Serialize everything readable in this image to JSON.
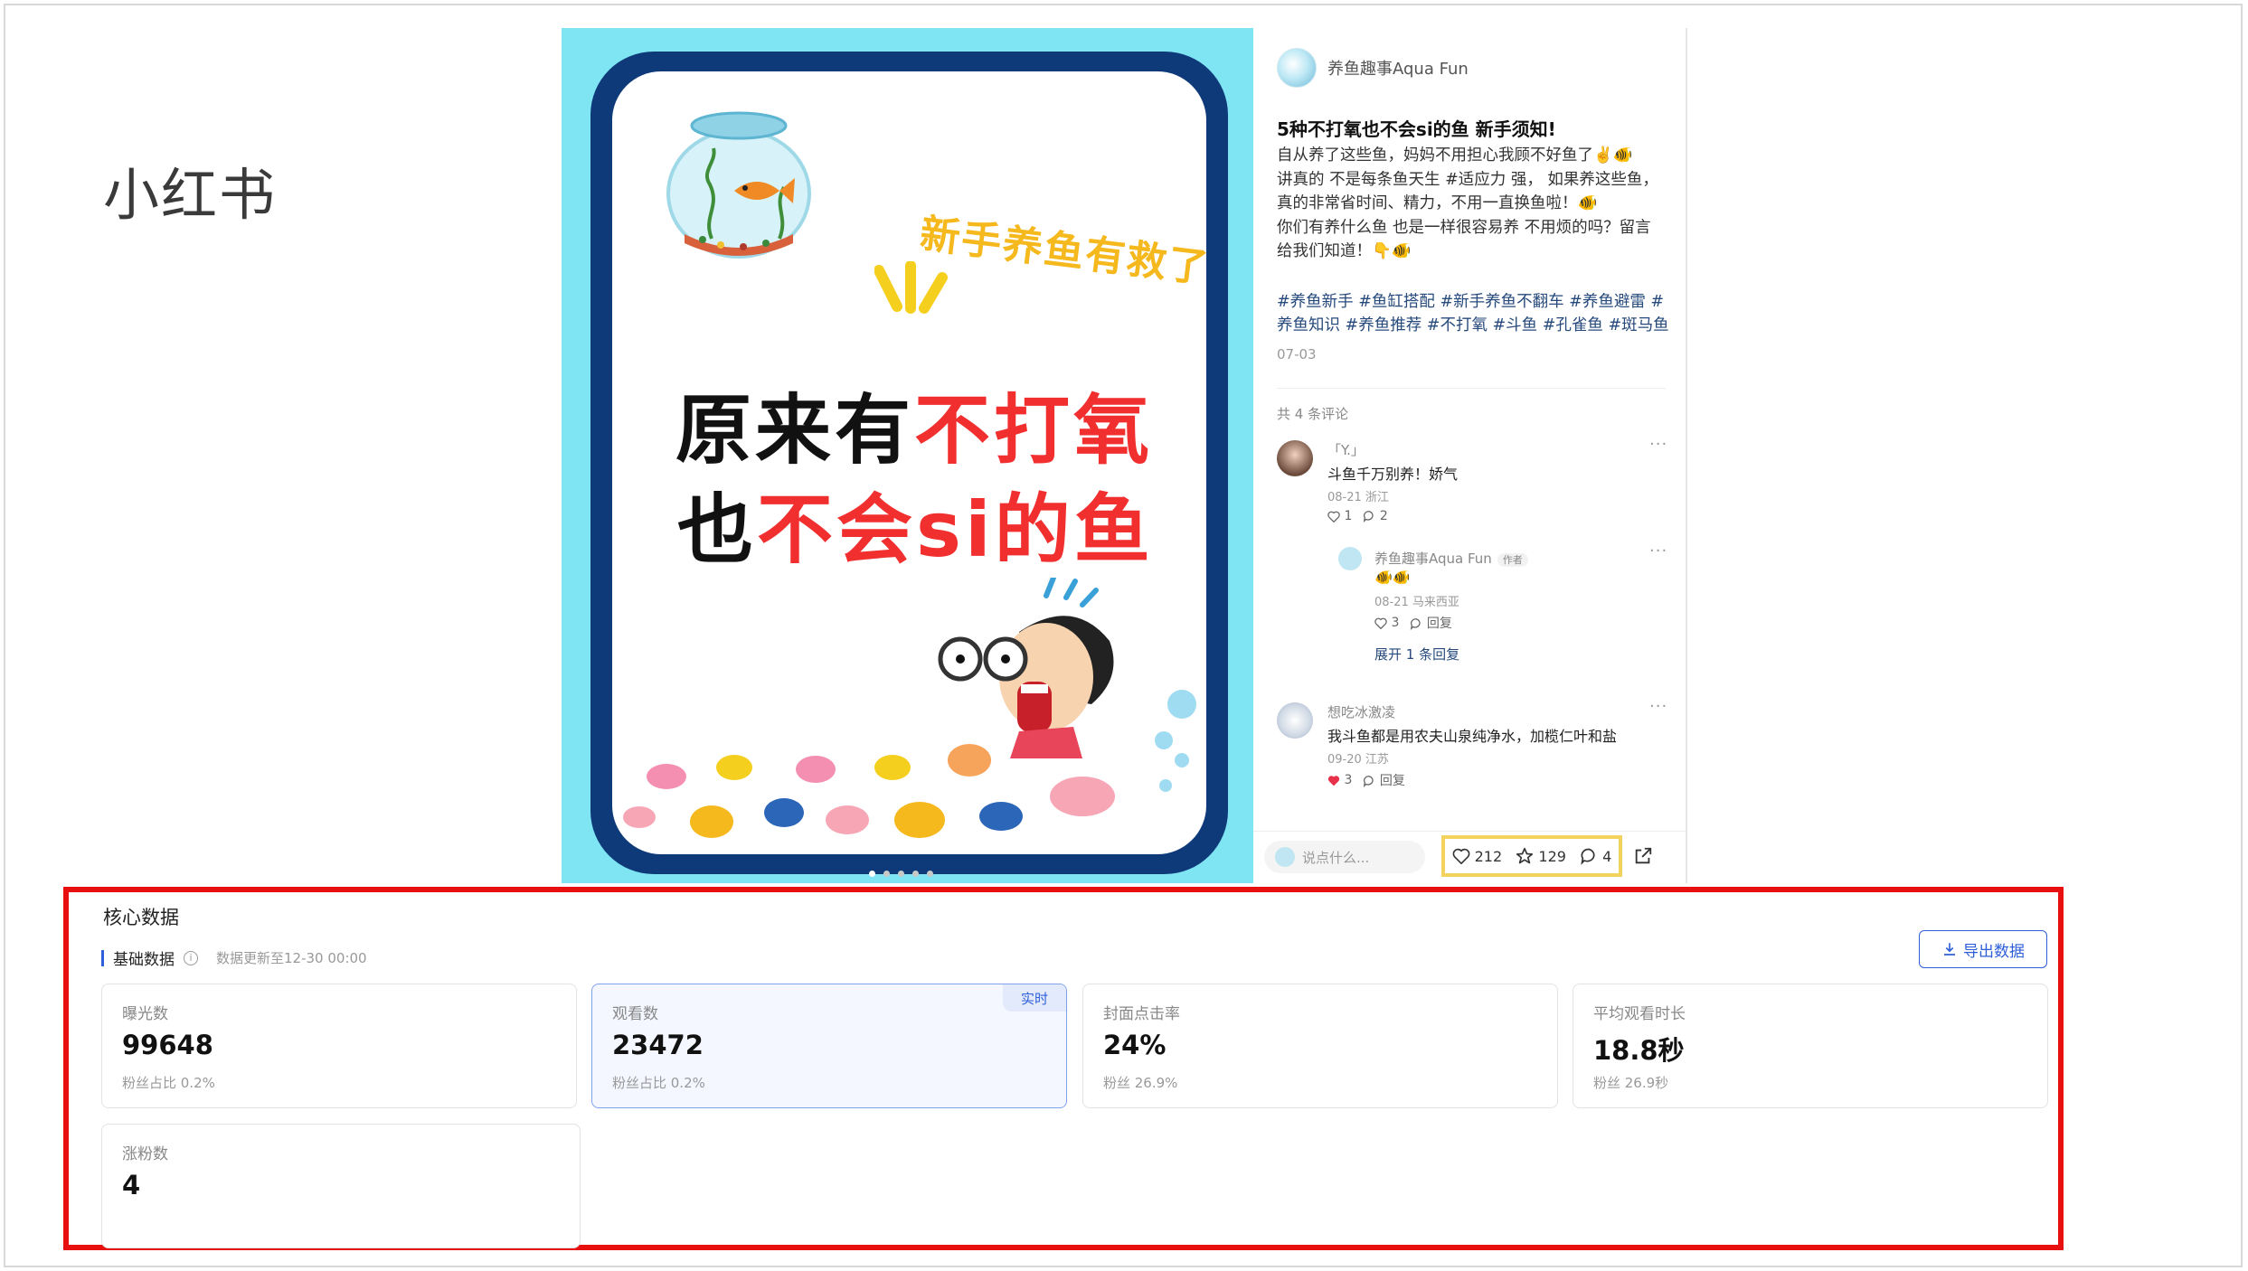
{
  "app_label": "小红书",
  "post_image": {
    "tagline": "新手养鱼有救了!",
    "headline_line1_dark": "原来有",
    "headline_line1_red": "不打氧",
    "headline_line2_dark": "也",
    "headline_line2_red": "不会si的鱼",
    "page_count": 5,
    "current_page": 1
  },
  "post": {
    "author": "养鱼趣事Aqua Fun",
    "title": "5种不打氧也不会si的鱼 新手须知!",
    "body": "自从养了这些鱼，妈妈不用担心我顾不好鱼了✌️🐠\n讲真的 不是每条鱼天生 #适应力 强， 如果养这些鱼，\n真的非常省时间、精力，不用一直换鱼啦！🐠\n你们有养什么鱼 也是一样很容易养 不用烦的吗？留言\n给我们知道！👇🐠",
    "hashtags": "#养鱼新手 #鱼缸搭配 #新手养鱼不翻车 #养鱼避雷 #养鱼知识 #养鱼推荐 #不打氧 #斗鱼 #孔雀鱼 #斑马鱼",
    "date": "07-03",
    "comment_count_label": "共 4 条评论"
  },
  "comments": [
    {
      "user": "「Y.」",
      "text": "斗鱼千万别养！娇气",
      "meta": "08-21 浙江",
      "likes": "1",
      "replies": "2"
    },
    {
      "user": "养鱼趣事Aqua Fun",
      "author_tag": "作者",
      "text": "🐠🐠",
      "meta": "08-21 马来西亚",
      "likes": "3",
      "reply_label": "回复",
      "expand": "展开 1 条回复"
    },
    {
      "user": "想吃冰激凌",
      "text": "我斗鱼都是用农夫山泉纯净水，加榄仁叶和盐",
      "meta": "09-20 江苏",
      "likes": "3",
      "reply_label": "回复"
    }
  ],
  "bottom_bar": {
    "input_placeholder": "说点什么...",
    "likes": "212",
    "collects": "129",
    "comments": "4"
  },
  "core_data": {
    "title": "核心数据",
    "tab_label": "基础数据",
    "update_text": "数据更新至12-30 00:00",
    "export_label": "导出数据",
    "metrics": [
      {
        "label": "曝光数",
        "value": "99648",
        "sub": "粉丝占比 0.2%"
      },
      {
        "label": "观看数",
        "value": "23472",
        "sub": "粉丝占比 0.2%",
        "badge": "实时"
      },
      {
        "label": "封面点击率",
        "value": "24%",
        "sub": "粉丝 26.9%"
      },
      {
        "label": "平均观看时长",
        "value": "18.8秒",
        "sub": "粉丝 26.9秒"
      },
      {
        "label": "涨粉数",
        "value": "4",
        "sub": ""
      }
    ]
  },
  "colors": {
    "highlight_red": "#e8100f",
    "stats_highlight": "#f3d25e",
    "brand_blue": "#2f5fd8",
    "poster_bg": "#7fe5f3",
    "poster_frame": "#0e3a7a"
  }
}
